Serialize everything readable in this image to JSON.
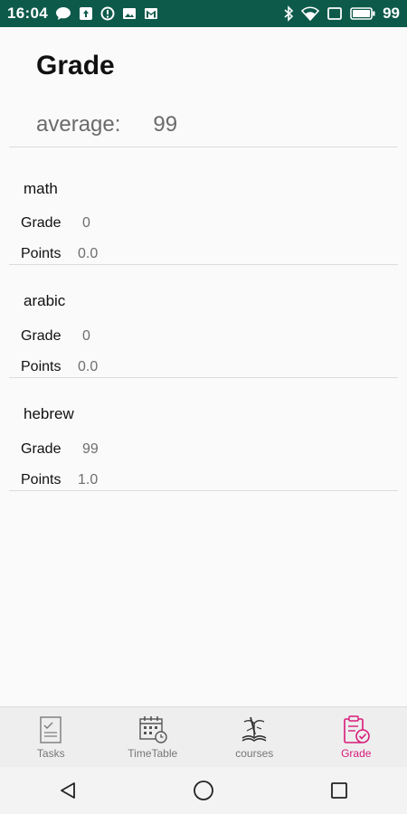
{
  "status_bar": {
    "time": "16:04",
    "battery": "99",
    "left_icons": [
      "chat-bubble-icon",
      "notification-icon",
      "alert-icon",
      "image-icon",
      "gmail-icon"
    ],
    "right_icons": [
      "bluetooth-icon",
      "wifi-icon",
      "screen-cast-icon",
      "battery-icon"
    ]
  },
  "header": {
    "title": "Grade",
    "average_label": "average:",
    "average_value": "99"
  },
  "courses": [
    {
      "name": "math",
      "grade_label": "Grade",
      "grade": "0",
      "points_label": "Points",
      "points": "0.0"
    },
    {
      "name": "arabic",
      "grade_label": "Grade",
      "grade": "0",
      "points_label": "Points",
      "points": "0.0"
    },
    {
      "name": "hebrew",
      "grade_label": "Grade",
      "grade": "99",
      "points_label": "Points",
      "points": "1.0"
    }
  ],
  "bottom_nav": {
    "items": [
      {
        "label": "Tasks",
        "icon": "tasks-icon"
      },
      {
        "label": "TimeTable",
        "icon": "timetable-icon"
      },
      {
        "label": "courses",
        "icon": "courses-icon"
      },
      {
        "label": "Grade",
        "icon": "grade-icon",
        "active": true
      }
    ],
    "active_color": "#d81b7a"
  },
  "colors": {
    "status_bar": "#0d5a4b",
    "background": "#fafafa",
    "accent": "#d81b7a"
  }
}
